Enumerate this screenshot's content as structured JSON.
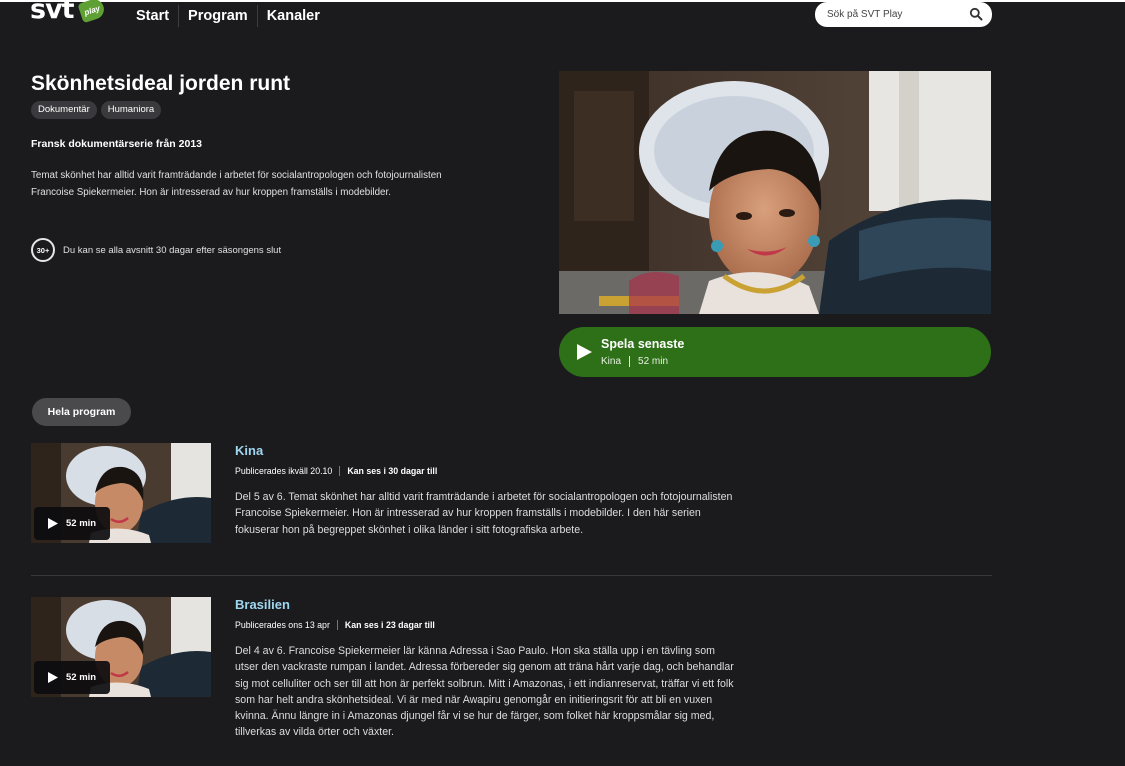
{
  "header": {
    "logo_text": "svt",
    "logo_badge": "play",
    "nav": [
      "Start",
      "Program",
      "Kanaler"
    ],
    "search_placeholder": "Sök på SVT Play"
  },
  "program": {
    "title": "Skönhetsideal jorden runt",
    "tags": [
      "Dokumentär",
      "Humaniora"
    ],
    "subtitle": "Fransk dokumentärserie från 2013",
    "description": "Temat skönhet har alltid varit framträdande i arbetet för socialantropologen och fotojournalisten Francoise Spiekermeier. Hon är intresserad av hur kroppen framställs i modebilder.",
    "availability_badge": "30+",
    "availability_text": "Du kan se alla avsnitt 30 dagar efter säsongens slut"
  },
  "play_latest": {
    "label": "Spela senaste",
    "episode": "Kina",
    "duration": "52 min"
  },
  "filter": {
    "label": "Hela program"
  },
  "episodes": [
    {
      "title": "Kina",
      "published": "Publicerades ikväll 20.10",
      "available": "Kan ses i 30 dagar till",
      "duration": "52 min",
      "description": "Del 5 av 6. Temat skönhet har alltid varit framträdande i arbetet för socialantropologen och fotojournalisten Francoise Spiekermeier. Hon är intresserad av hur kroppen framställs i modebilder. I den här serien fokuserar hon på begreppet skönhet i olika länder i sitt fotografiska arbete."
    },
    {
      "title": "Brasilien",
      "published": "Publicerades ons 13 apr",
      "available": "Kan ses i 23 dagar till",
      "duration": "52 min",
      "description": "Del 4 av 6. Francoise Spiekermeier lär känna Adressa i Sao Paulo. Hon ska ställa upp i en tävling som utser den vackraste rumpan i landet. Adressa förbereder sig genom att träna hårt varje dag, och behandlar sig mot celluliter och ser till att hon är perfekt solbrun. Mitt i Amazonas, i ett indianreservat, träffar vi ett folk som har helt andra skönhetsideal. Vi är med när Awapiru genomgår en initieringsrit för att bli en vuxen kvinna. Ännu längre in i Amazonas djungel får vi se hur de färger, som folket här kroppsmålar sig med, tillverkas av vilda örter och växter."
    }
  ],
  "colors": {
    "background": "#1b1b1e",
    "play_green": "#2e7018",
    "episode_title": "#9fd6ef",
    "tag_bg": "#3a3a3e"
  },
  "icons": [
    "search-icon",
    "play-icon",
    "availability-30-icon"
  ]
}
